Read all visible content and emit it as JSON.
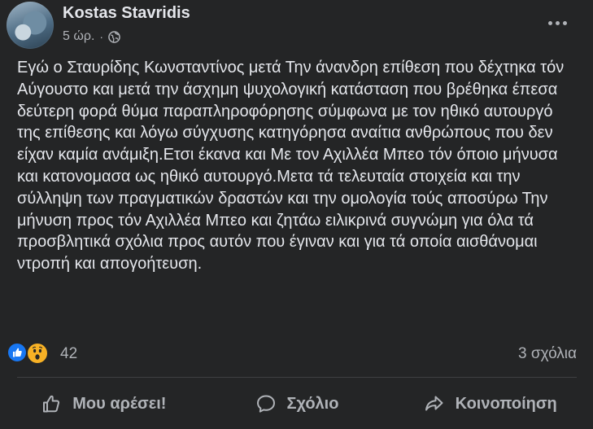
{
  "post": {
    "author": "Kostas Stavridis",
    "time": "5 ώρ.",
    "separator": "·",
    "privacy_icon": "globe-icon",
    "text": "Εγώ ο Σταυρίδης Κωνσταντίνος μετά Την άνανδρη επίθεση που δέχτηκα τόν Αύγουστο και μετά την άσχημη ψυχολογική κατάσταση που βρέθηκα έπεσα δεύτερη φορά θύμα παραπληροφόρησης σύμφωνα με τον ηθικό αυτουργό της επίθεσης και λόγω σύγχυσης κατηγόρησα αναίτια ανθρώπους που δεν είχαν καμία ανάμιξη.Ετσι έκανα και Με τον Αχιλλέα Μπεο τόν όποιο μήνυσα και κατονομασα ως ηθικό αυτουργό.Μετα τά τελευταία στοιχεία και την σύλληψη των πραγματικών δραστών και την ομολογία τούς αποσύρω Την μήνυση προς τόν Αχιλλέα Μπεο και ζητάω ειλικρινά συγνώμη για όλα τά προσβλητικά σχόλια προς αυτόν που έγιναν και για τά οποία αισθάνομαι ντροπή και απογοήτευση."
  },
  "reactions": {
    "icons": [
      "like-reaction-icon",
      "wow-reaction-icon"
    ],
    "count": "42",
    "comments": "3 σχόλια"
  },
  "actions": {
    "like_label": "Μου αρέσει!",
    "comment_label": "Σχόλιο",
    "share_label": "Κοινοποίηση"
  },
  "colors": {
    "background": "#242526",
    "primary_text": "#e4e6eb",
    "secondary_text": "#b0b3b8",
    "like_blue": "#1877f2",
    "wow_yellow": "#f7b125"
  }
}
